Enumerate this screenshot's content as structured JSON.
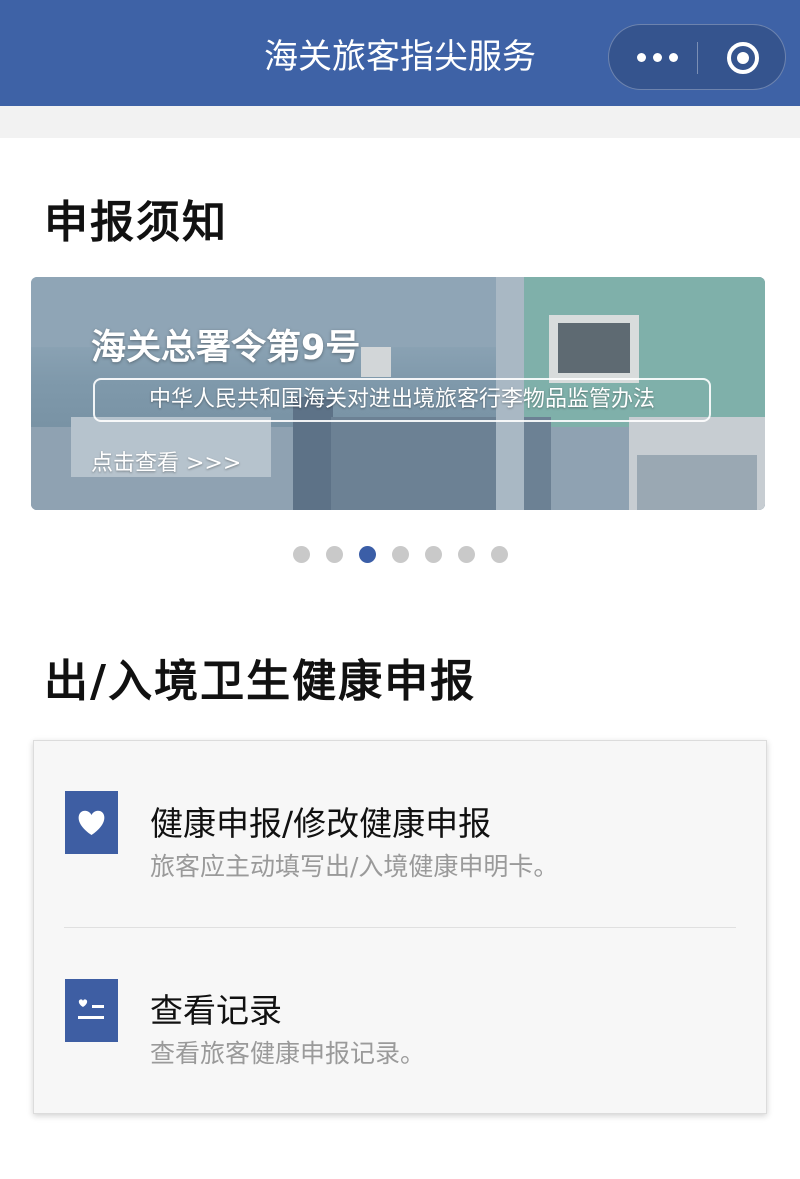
{
  "header": {
    "title": "海关旅客指尖服务",
    "more_icon": "more-icon",
    "close_icon": "target-close-icon",
    "color": "#3e62a6"
  },
  "notice": {
    "title": "申报须知",
    "banner": {
      "heading": "海关总署令第9号",
      "subtitle": "中华人民共和国海关对进出境旅客行李物品监管办法",
      "link": "点击查看 >>>"
    },
    "carousel": {
      "total": 7,
      "active_index": 2,
      "active_color": "#3b5ea7"
    }
  },
  "health": {
    "title": "出/入境卫生健康申报",
    "items": [
      {
        "icon": "heart-icon",
        "title": "健康申报/修改健康申报",
        "desc": "旅客应主动填写出/入境健康申明卡。"
      },
      {
        "icon": "record-list-icon",
        "title": "查看记录",
        "desc": "查看旅客健康申报记录。"
      }
    ]
  }
}
